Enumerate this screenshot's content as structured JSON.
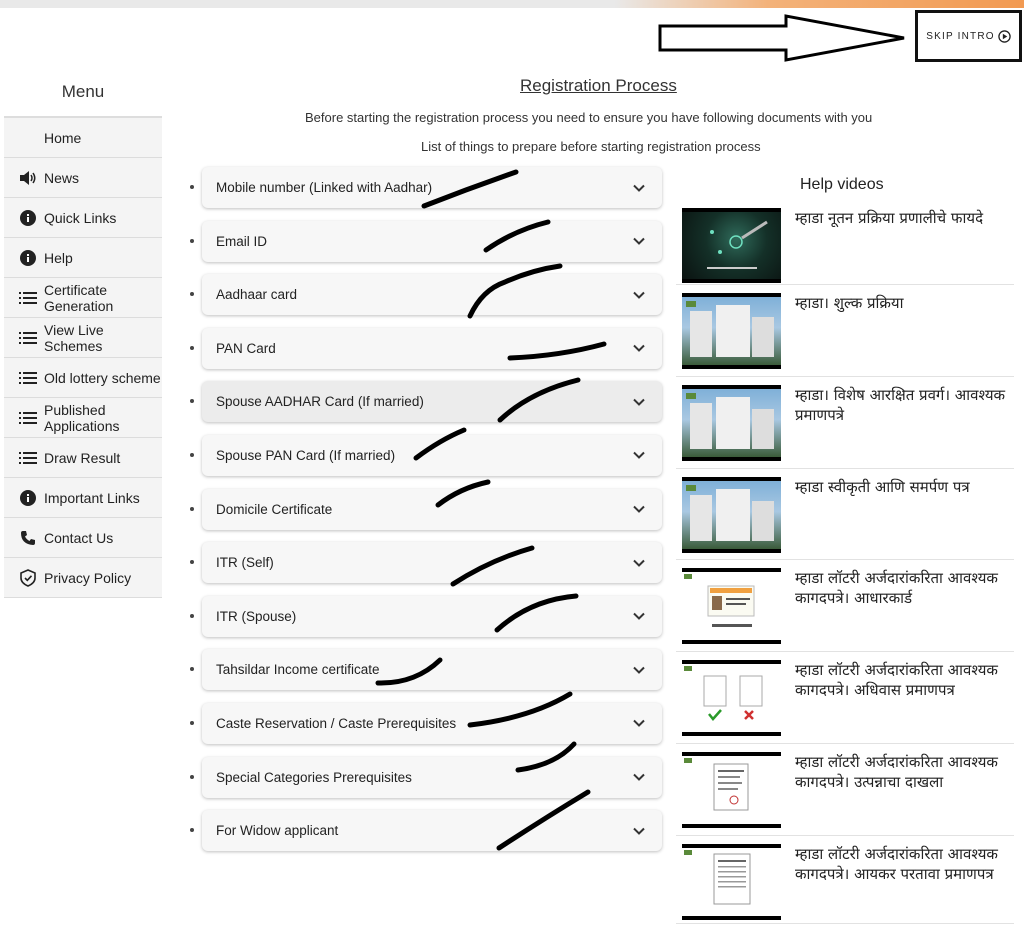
{
  "skip_intro": {
    "label": "SKIP INTRO",
    "icon": "play-circle-icon"
  },
  "menu": {
    "title": "Menu",
    "items": [
      {
        "label": "Home",
        "icon": ""
      },
      {
        "label": "News",
        "icon": "speaker-icon"
      },
      {
        "label": "Quick Links",
        "icon": "info-icon"
      },
      {
        "label": "Help",
        "icon": "info-icon"
      },
      {
        "label": "Certificate Generation",
        "icon": "list-icon"
      },
      {
        "label": "View Live Schemes",
        "icon": "list-icon"
      },
      {
        "label": "Old lottery scheme",
        "icon": "list-icon"
      },
      {
        "label": "Published Applications",
        "icon": "list-icon"
      },
      {
        "label": "Draw Result",
        "icon": "list-icon"
      },
      {
        "label": "Important Links",
        "icon": "info-icon"
      },
      {
        "label": "Contact Us",
        "icon": "phone-icon"
      },
      {
        "label": "Privacy Policy",
        "icon": "shield-icon"
      }
    ]
  },
  "main": {
    "title": "Registration Process",
    "intro": "Before starting the registration process you need to ensure you have following documents with you",
    "subintro": "List of things to prepare before starting registration process",
    "documents": [
      {
        "label": "Mobile number (Linked with Aadhar)"
      },
      {
        "label": "Email ID"
      },
      {
        "label": "Aadhaar card"
      },
      {
        "label": "PAN Card"
      },
      {
        "label": "Spouse AADHAR Card (If married)"
      },
      {
        "label": "Spouse PAN Card (If married)"
      },
      {
        "label": "Domicile Certificate"
      },
      {
        "label": "ITR (Self)"
      },
      {
        "label": "ITR (Spouse)"
      },
      {
        "label": "Tahsildar Income certificate"
      },
      {
        "label": "Caste Reservation / Caste Prerequisites"
      },
      {
        "label": "Special Categories Prerequisites"
      },
      {
        "label": "For Widow applicant"
      }
    ]
  },
  "help": {
    "title": "Help videos",
    "videos": [
      {
        "title": "म्हाडा नूतन प्रक्रिया प्रणालीचे फायदे"
      },
      {
        "title": "म्हाडा। शुल्क प्रक्रिया"
      },
      {
        "title": "म्हाडा। विशेष आरक्षित प्रवर्ग। आवश्यक प्रमाणपत्रे"
      },
      {
        "title": "म्हाडा स्वीकृती आणि समर्पण पत्र"
      },
      {
        "title": "म्हाडा लॉटरी अर्जदारांकरिता आवश्यक कागदपत्रे। आधारकार्ड"
      },
      {
        "title": "म्हाडा लॉटरी अर्जदारांकरिता आवश्यक कागदपत्रे। अधिवास प्रमाणपत्र"
      },
      {
        "title": "म्हाडा लॉटरी अर्जदारांकरिता आवश्यक कागदपत्रे। उत्पन्नाचा दाखला"
      },
      {
        "title": "म्हाडा लॉटरी अर्जदारांकरिता आवश्यक कागदपत्रे। आयकर परतावा प्रमाणपत्र"
      }
    ]
  }
}
